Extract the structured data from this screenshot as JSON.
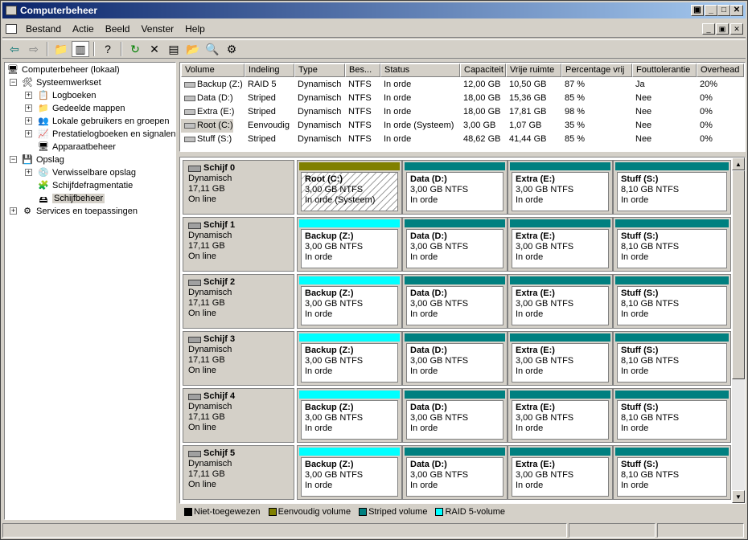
{
  "window": {
    "title": "Computerbeheer"
  },
  "menu": [
    "Bestand",
    "Actie",
    "Beeld",
    "Venster",
    "Help"
  ],
  "toolbar_icons": [
    "back-icon",
    "forward-icon",
    "up-folder-icon",
    "show-hide-tree-icon",
    "help-icon",
    "refresh-icon",
    "delete-icon",
    "properties-icon",
    "open-icon",
    "search-icon",
    "settings-icon"
  ],
  "tree": {
    "root": "Computerbeheer (lokaal)",
    "items": [
      {
        "label": "Systeemwerkset"
      },
      {
        "label": "Logboeken"
      },
      {
        "label": "Gedeelde mappen"
      },
      {
        "label": "Lokale gebruikers en groepen"
      },
      {
        "label": "Prestatielogboeken en signalen"
      },
      {
        "label": "Apparaatbeheer"
      },
      {
        "label": "Opslag"
      },
      {
        "label": "Verwisselbare opslag"
      },
      {
        "label": "Schijfdefragmentatie"
      },
      {
        "label": "Schijfbeheer"
      },
      {
        "label": "Services en toepassingen"
      }
    ]
  },
  "volumes": {
    "headers": [
      "Volume",
      "Indeling",
      "Type",
      "Bes...",
      "Status",
      "Capaciteit",
      "Vrije ruimte",
      "Percentage vrij",
      "Fouttolerantie",
      "Overhead"
    ],
    "rows": [
      [
        "Backup (Z:)",
        "RAID 5",
        "Dynamisch",
        "NTFS",
        "In orde",
        "12,00 GB",
        "10,50 GB",
        "87 %",
        "Ja",
        "20%"
      ],
      [
        "Data (D:)",
        "Striped",
        "Dynamisch",
        "NTFS",
        "In orde",
        "18,00 GB",
        "15,36 GB",
        "85 %",
        "Nee",
        "0%"
      ],
      [
        "Extra (E:)",
        "Striped",
        "Dynamisch",
        "NTFS",
        "In orde",
        "18,00 GB",
        "17,81 GB",
        "98 %",
        "Nee",
        "0%"
      ],
      [
        "Root (C:)",
        "Eenvoudig",
        "Dynamisch",
        "NTFS",
        "In orde (Systeem)",
        "3,00 GB",
        "1,07 GB",
        "35 %",
        "Nee",
        "0%"
      ],
      [
        "Stuff (S:)",
        "Striped",
        "Dynamisch",
        "NTFS",
        "In orde",
        "48,62 GB",
        "41,44 GB",
        "85 %",
        "Nee",
        "0%"
      ]
    ]
  },
  "disks": [
    {
      "name": "Schijf 0",
      "type": "Dynamisch",
      "size": "17,11 GB",
      "state": "On line",
      "parts": [
        {
          "name": "Root  (C:)",
          "size": "3,00 GB NTFS",
          "status": "In orde (Systeem)",
          "kind": "simple"
        },
        {
          "name": "Data  (D:)",
          "size": "3,00 GB NTFS",
          "status": "In orde",
          "kind": "striped"
        },
        {
          "name": "Extra  (E:)",
          "size": "3,00 GB NTFS",
          "status": "In orde",
          "kind": "striped"
        },
        {
          "name": "Stuff  (S:)",
          "size": "8,10 GB NTFS",
          "status": "In orde",
          "kind": "striped"
        }
      ]
    },
    {
      "name": "Schijf 1",
      "type": "Dynamisch",
      "size": "17,11 GB",
      "state": "On line",
      "parts": [
        {
          "name": "Backup  (Z:)",
          "size": "3,00 GB NTFS",
          "status": "In orde",
          "kind": "raid5"
        },
        {
          "name": "Data  (D:)",
          "size": "3,00 GB NTFS",
          "status": "In orde",
          "kind": "striped"
        },
        {
          "name": "Extra  (E:)",
          "size": "3,00 GB NTFS",
          "status": "In orde",
          "kind": "striped"
        },
        {
          "name": "Stuff  (S:)",
          "size": "8,10 GB NTFS",
          "status": "In orde",
          "kind": "striped"
        }
      ]
    },
    {
      "name": "Schijf 2",
      "type": "Dynamisch",
      "size": "17,11 GB",
      "state": "On line",
      "parts": [
        {
          "name": "Backup  (Z:)",
          "size": "3,00 GB NTFS",
          "status": "In orde",
          "kind": "raid5"
        },
        {
          "name": "Data  (D:)",
          "size": "3,00 GB NTFS",
          "status": "In orde",
          "kind": "striped"
        },
        {
          "name": "Extra  (E:)",
          "size": "3,00 GB NTFS",
          "status": "In orde",
          "kind": "striped"
        },
        {
          "name": "Stuff  (S:)",
          "size": "8,10 GB NTFS",
          "status": "In orde",
          "kind": "striped"
        }
      ]
    },
    {
      "name": "Schijf 3",
      "type": "Dynamisch",
      "size": "17,11 GB",
      "state": "On line",
      "parts": [
        {
          "name": "Backup  (Z:)",
          "size": "3,00 GB NTFS",
          "status": "In orde",
          "kind": "raid5"
        },
        {
          "name": "Data  (D:)",
          "size": "3,00 GB NTFS",
          "status": "In orde",
          "kind": "striped"
        },
        {
          "name": "Extra  (E:)",
          "size": "3,00 GB NTFS",
          "status": "In orde",
          "kind": "striped"
        },
        {
          "name": "Stuff  (S:)",
          "size": "8,10 GB NTFS",
          "status": "In orde",
          "kind": "striped"
        }
      ]
    },
    {
      "name": "Schijf 4",
      "type": "Dynamisch",
      "size": "17,11 GB",
      "state": "On line",
      "parts": [
        {
          "name": "Backup  (Z:)",
          "size": "3,00 GB NTFS",
          "status": "In orde",
          "kind": "raid5"
        },
        {
          "name": "Data  (D:)",
          "size": "3,00 GB NTFS",
          "status": "In orde",
          "kind": "striped"
        },
        {
          "name": "Extra  (E:)",
          "size": "3,00 GB NTFS",
          "status": "In orde",
          "kind": "striped"
        },
        {
          "name": "Stuff  (S:)",
          "size": "8,10 GB NTFS",
          "status": "In orde",
          "kind": "striped"
        }
      ]
    },
    {
      "name": "Schijf 5",
      "type": "Dynamisch",
      "size": "17,11 GB",
      "state": "On line",
      "parts": [
        {
          "name": "Backup  (Z:)",
          "size": "3,00 GB NTFS",
          "status": "In orde",
          "kind": "raid5"
        },
        {
          "name": "Data  (D:)",
          "size": "3,00 GB NTFS",
          "status": "In orde",
          "kind": "striped"
        },
        {
          "name": "Extra  (E:)",
          "size": "3,00 GB NTFS",
          "status": "In orde",
          "kind": "striped"
        },
        {
          "name": "Stuff  (S:)",
          "size": "8,10 GB NTFS",
          "status": "In orde",
          "kind": "striped"
        }
      ]
    }
  ],
  "legend": [
    {
      "label": "Niet-toegewezen",
      "color": "#000000"
    },
    {
      "label": "Eenvoudig volume",
      "color": "#808000"
    },
    {
      "label": "Striped volume",
      "color": "#008080"
    },
    {
      "label": "RAID 5-volume",
      "color": "#00ffff"
    }
  ],
  "colors": {
    "simple": "#808000",
    "striped": "#008080",
    "raid5": "#00ffff"
  }
}
